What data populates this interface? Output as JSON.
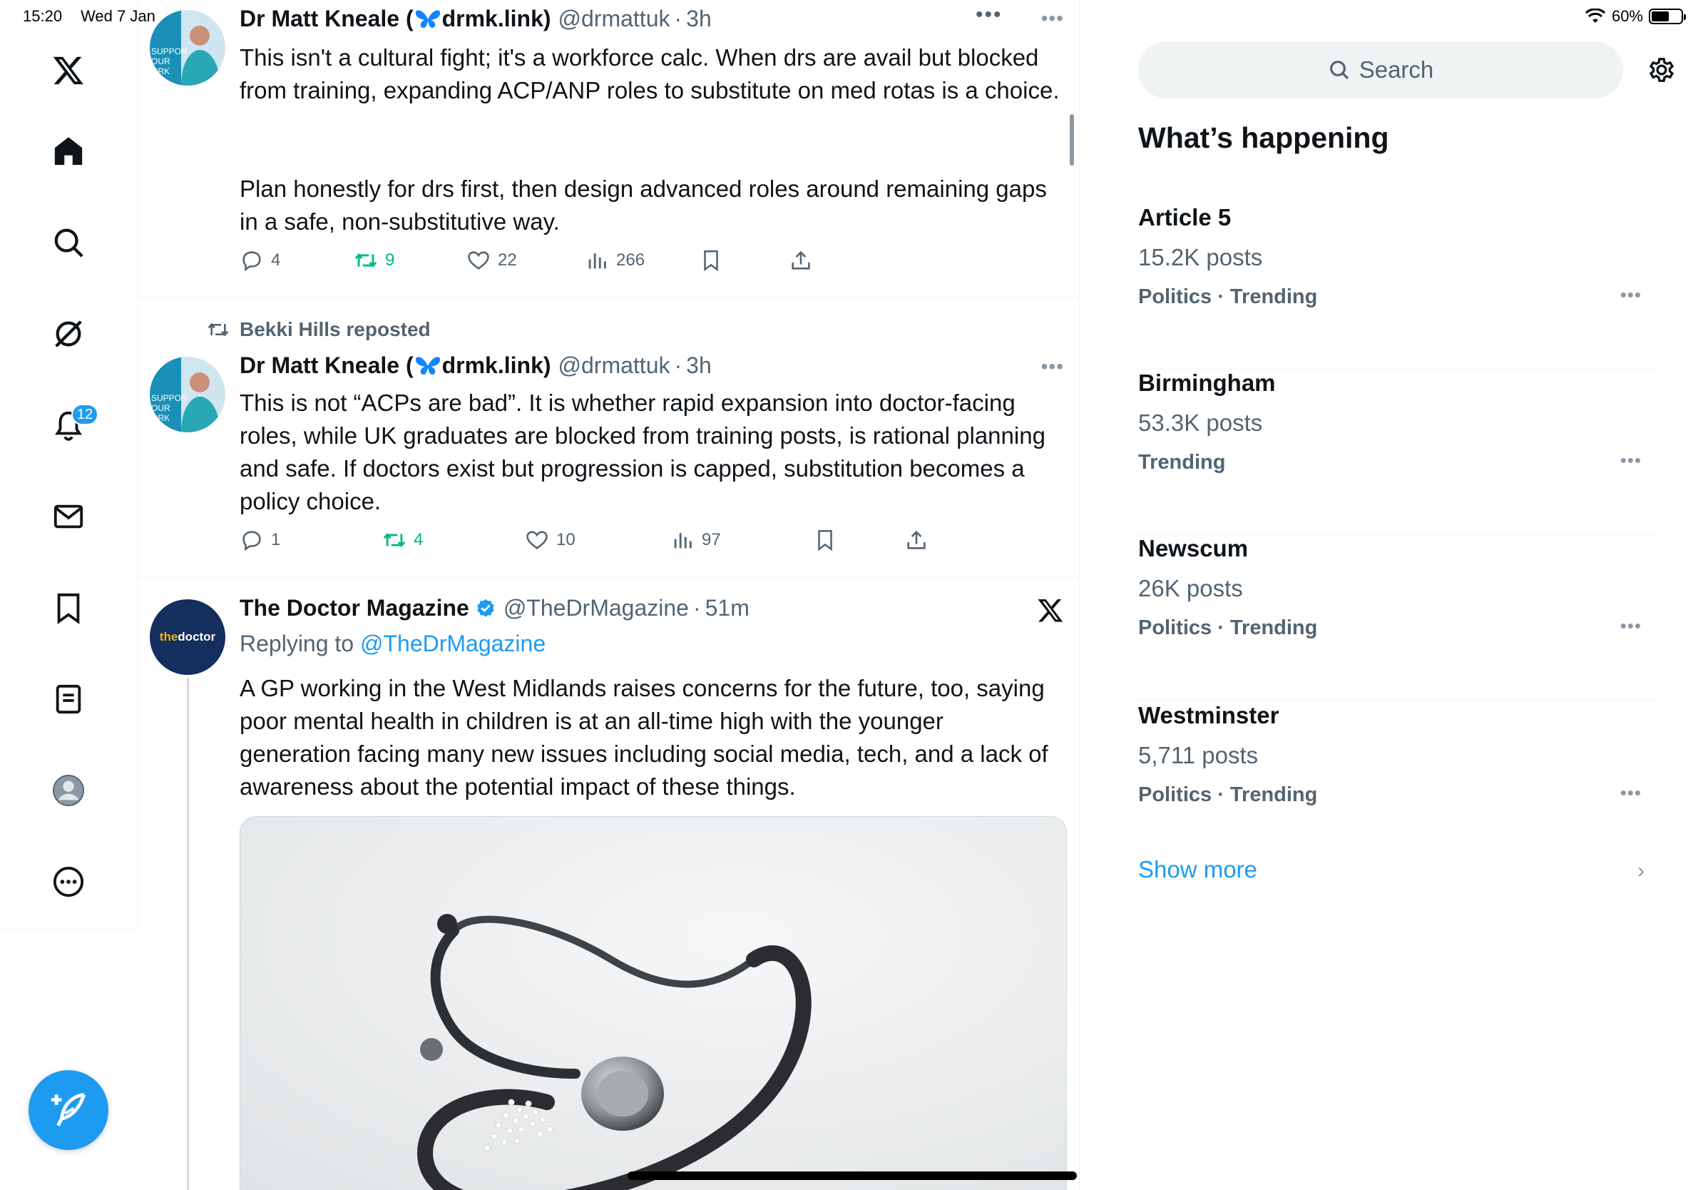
{
  "status_bar": {
    "time": "15:20",
    "date": "Wed 7 Jan",
    "battery": "60%",
    "battery_level": 0.6
  },
  "nav": {
    "notifications_badge": "12"
  },
  "posts": [
    {
      "author": "Dr Matt Kneale (🦋drmk.link)",
      "author_name": "Dr Matt Kneale (",
      "author_link": "drmk.link)",
      "handle": "@drmattuk",
      "time": "3h",
      "text_p1": "This isn't a cultural fight; it's a workforce calc. When drs are avail but blocked from training, expanding ACP/ANP roles to substitute on med rotas is a choice.",
      "text_p2": "Plan honestly for drs first, then design advanced roles around remaining gaps in a safe, non-substitutive way.",
      "replies": "4",
      "reposts": "9",
      "likes": "22",
      "views": "266"
    },
    {
      "reposted_by": "Bekki Hills reposted",
      "author_name": "Dr Matt Kneale (",
      "author_link": "drmk.link)",
      "handle": "@drmattuk",
      "time": "3h",
      "text": "This is not “ACPs are bad”. It is whether rapid expansion into doctor-facing roles, while UK graduates are blocked from training posts, is rational planning and safe. If doctors exist but progression is capped, substitution becomes a policy choice.",
      "replies": "1",
      "reposts": "4",
      "likes": "10",
      "views": "97"
    },
    {
      "author_name": "The Doctor Magazine",
      "handle": "@TheDrMagazine",
      "time": "51m",
      "replying_prefix": "Replying to",
      "replying_to": "@TheDrMagazine",
      "avatar_text_a": "the",
      "avatar_text_b": "doctor",
      "text": "A GP working in the West Midlands raises concerns for the future, too, saying poor mental health in children is at an all-time high with the younger generation facing many new issues including social media, tech, and a lack of awareness about the potential impact of these things."
    }
  ],
  "avatar_sign": {
    "l1": "SUPPOR",
    "l2": "OUR",
    "l3": "ORK"
  },
  "sidebar": {
    "search_placeholder": "Search",
    "section_title": "What’s happening",
    "trends": [
      {
        "name": "Article 5",
        "count": "15.2K posts",
        "category": "Politics · Trending"
      },
      {
        "name": "Birmingham",
        "count": "53.3K posts",
        "category": "Trending"
      },
      {
        "name": "Newscum",
        "count": "26K posts",
        "category": "Politics · Trending"
      },
      {
        "name": "Westminster",
        "count": "5,711 posts",
        "category": "Politics · Trending"
      }
    ],
    "show_more": "Show more"
  },
  "colors": {
    "accent": "#1d9bf0",
    "repost_green": "#00ba7c",
    "text_secondary": "#536471"
  }
}
